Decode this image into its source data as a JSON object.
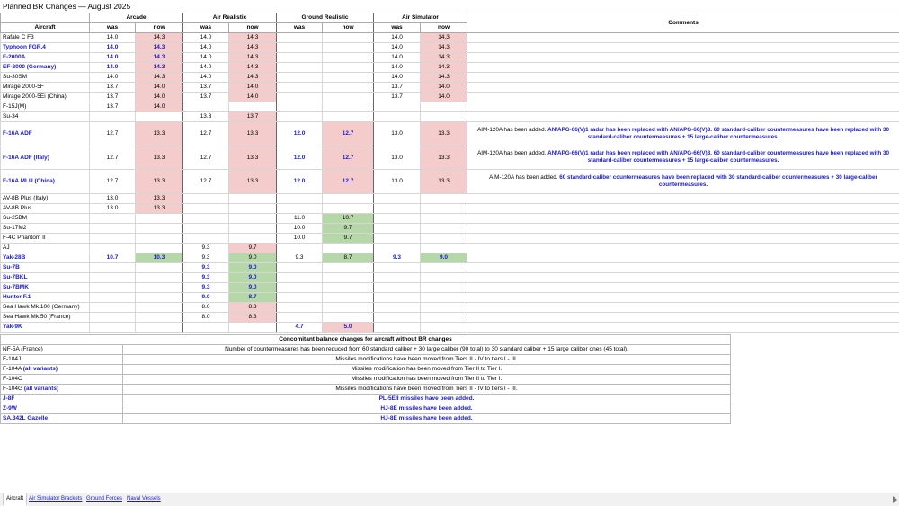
{
  "title": "Planned BR Changes — August 2025",
  "headers": {
    "aircraft": "Aircraft",
    "comments": "Comments",
    "modes": [
      "Arcade",
      "Air Realistic",
      "Ground Realistic",
      "Air Simulator"
    ],
    "was": "was",
    "now": "now"
  },
  "rows": [
    {
      "name": "Rafale C F3",
      "name_style": "",
      "cells": [
        {
          "t": "14.0"
        },
        {
          "t": "14.3",
          "bg": "red"
        },
        {
          "t": "14.0"
        },
        {
          "t": "14.3",
          "bg": "red"
        },
        {
          "t": ""
        },
        {
          "t": ""
        },
        {
          "t": "14.0"
        },
        {
          "t": "14.3",
          "bg": "red"
        }
      ]
    },
    {
      "name": "Typhoon FGR.4",
      "name_style": "blue",
      "cells": [
        {
          "t": "14.0",
          "s": "blue"
        },
        {
          "t": "14.3",
          "bg": "red",
          "s": "blue"
        },
        {
          "t": "14.0"
        },
        {
          "t": "14.3",
          "bg": "red"
        },
        {
          "t": ""
        },
        {
          "t": ""
        },
        {
          "t": "14.0"
        },
        {
          "t": "14.3",
          "bg": "red"
        }
      ]
    },
    {
      "name": "F-2000A",
      "name_style": "blue",
      "cells": [
        {
          "t": "14.0",
          "s": "blue"
        },
        {
          "t": "14.3",
          "bg": "red",
          "s": "blue"
        },
        {
          "t": "14.0"
        },
        {
          "t": "14.3",
          "bg": "red"
        },
        {
          "t": ""
        },
        {
          "t": ""
        },
        {
          "t": "14.0"
        },
        {
          "t": "14.3",
          "bg": "red"
        }
      ]
    },
    {
      "name": "EF-2000 (Germany)",
      "name_style": "blue",
      "cells": [
        {
          "t": "14.0",
          "s": "blue"
        },
        {
          "t": "14.3",
          "bg": "red",
          "s": "blue"
        },
        {
          "t": "14.0"
        },
        {
          "t": "14.3",
          "bg": "red"
        },
        {
          "t": ""
        },
        {
          "t": ""
        },
        {
          "t": "14.0"
        },
        {
          "t": "14.3",
          "bg": "red"
        }
      ]
    },
    {
      "name": "Su-30SM",
      "name_style": "",
      "cells": [
        {
          "t": "14.0"
        },
        {
          "t": "14.3",
          "bg": "red"
        },
        {
          "t": "14.0"
        },
        {
          "t": "14.3",
          "bg": "red"
        },
        {
          "t": ""
        },
        {
          "t": ""
        },
        {
          "t": "14.0"
        },
        {
          "t": "14.3",
          "bg": "red"
        }
      ]
    },
    {
      "name": "Mirage 2000-5F",
      "name_style": "",
      "cells": [
        {
          "t": "13.7"
        },
        {
          "t": "14.0",
          "bg": "red"
        },
        {
          "t": "13.7"
        },
        {
          "t": "14.0",
          "bg": "red"
        },
        {
          "t": ""
        },
        {
          "t": ""
        },
        {
          "t": "13.7"
        },
        {
          "t": "14.0",
          "bg": "red"
        }
      ]
    },
    {
      "name": "Mirage 2000-5Ei (China)",
      "name_style": "",
      "cells": [
        {
          "t": "13.7"
        },
        {
          "t": "14.0",
          "bg": "red"
        },
        {
          "t": "13.7"
        },
        {
          "t": "14.0",
          "bg": "red"
        },
        {
          "t": ""
        },
        {
          "t": ""
        },
        {
          "t": "13.7"
        },
        {
          "t": "14.0",
          "bg": "red"
        }
      ]
    },
    {
      "name": "F-15J(M)",
      "name_style": "",
      "cells": [
        {
          "t": "13.7"
        },
        {
          "t": "14.0",
          "bg": "red"
        },
        {
          "t": ""
        },
        {
          "t": ""
        },
        {
          "t": ""
        },
        {
          "t": ""
        },
        {
          "t": ""
        },
        {
          "t": ""
        }
      ]
    },
    {
      "name": "Su-34",
      "name_style": "",
      "cells": [
        {
          "t": ""
        },
        {
          "t": ""
        },
        {
          "t": "13.3"
        },
        {
          "t": "13.7",
          "bg": "red"
        },
        {
          "t": ""
        },
        {
          "t": ""
        },
        {
          "t": ""
        },
        {
          "t": ""
        }
      ]
    },
    {
      "name": "F-16A ADF",
      "name_style": "blue",
      "tall": true,
      "cells": [
        {
          "t": "12.7"
        },
        {
          "t": "13.3",
          "bg": "red"
        },
        {
          "t": "12.7"
        },
        {
          "t": "13.3",
          "bg": "red"
        },
        {
          "t": "12.0",
          "s": "blue"
        },
        {
          "t": "12.7",
          "bg": "red",
          "s": "blue"
        },
        {
          "t": "13.0"
        },
        {
          "t": "13.3",
          "bg": "red"
        }
      ],
      "comment_plain": "AIM-120A has been added. ",
      "comment_blue": "AN/APG-66(V)1 radar has been replaced with AN/APG-66(V)3. 60 standard-caliber countermeasures have been replaced with 30 standard-caliber countermeasures + 15 large-caliber countermeasures."
    },
    {
      "name": "F-16A ADF (Italy)",
      "name_style": "blue",
      "tall": true,
      "cells": [
        {
          "t": "12.7"
        },
        {
          "t": "13.3",
          "bg": "red"
        },
        {
          "t": "12.7"
        },
        {
          "t": "13.3",
          "bg": "red"
        },
        {
          "t": "12.0",
          "s": "blue"
        },
        {
          "t": "12.7",
          "bg": "red",
          "s": "blue"
        },
        {
          "t": "13.0"
        },
        {
          "t": "13.3",
          "bg": "red"
        }
      ],
      "comment_plain": "AIM-120A has been added. ",
      "comment_blue": "AN/APG-66(V)1 radar has been replaced with AN/APG-66(V)3. 60 standard-caliber countermeasures have been replaced with 30 standard-caliber countermeasures + 15 large-caliber countermeasures."
    },
    {
      "name": "F-16A MLU (China)",
      "name_style": "blue",
      "tall": true,
      "cells": [
        {
          "t": "12.7"
        },
        {
          "t": "13.3",
          "bg": "red"
        },
        {
          "t": "12.7"
        },
        {
          "t": "13.3",
          "bg": "red"
        },
        {
          "t": "12.0",
          "s": "blue"
        },
        {
          "t": "12.7",
          "bg": "red",
          "s": "blue"
        },
        {
          "t": "13.0"
        },
        {
          "t": "13.3",
          "bg": "red"
        }
      ],
      "comment_plain": "AIM-120A has been added. ",
      "comment_blue": "60 standard-caliber countermeasures have been replaced with 30 standard-caliber countermeasures + 30 large-caliber countermeasures."
    },
    {
      "name": "AV-8B Plus (Italy)",
      "name_style": "",
      "cells": [
        {
          "t": "13.0"
        },
        {
          "t": "13.3",
          "bg": "red"
        },
        {
          "t": ""
        },
        {
          "t": ""
        },
        {
          "t": ""
        },
        {
          "t": ""
        },
        {
          "t": ""
        },
        {
          "t": ""
        }
      ]
    },
    {
      "name": "AV-8B Plus",
      "name_style": "",
      "cells": [
        {
          "t": "13.0"
        },
        {
          "t": "13.3",
          "bg": "red"
        },
        {
          "t": ""
        },
        {
          "t": ""
        },
        {
          "t": ""
        },
        {
          "t": ""
        },
        {
          "t": ""
        },
        {
          "t": ""
        }
      ]
    },
    {
      "name": "Su-25BM",
      "name_style": "",
      "cells": [
        {
          "t": ""
        },
        {
          "t": ""
        },
        {
          "t": ""
        },
        {
          "t": ""
        },
        {
          "t": "11.0"
        },
        {
          "t": "10.7",
          "bg": "green"
        },
        {
          "t": ""
        },
        {
          "t": ""
        }
      ]
    },
    {
      "name": "Su-17M2",
      "name_style": "",
      "cells": [
        {
          "t": ""
        },
        {
          "t": ""
        },
        {
          "t": ""
        },
        {
          "t": ""
        },
        {
          "t": "10.0"
        },
        {
          "t": "9.7",
          "bg": "green"
        },
        {
          "t": ""
        },
        {
          "t": ""
        }
      ]
    },
    {
      "name": "F-4C Phantom II",
      "name_style": "",
      "cells": [
        {
          "t": ""
        },
        {
          "t": ""
        },
        {
          "t": ""
        },
        {
          "t": ""
        },
        {
          "t": "10.0"
        },
        {
          "t": "9.7",
          "bg": "green"
        },
        {
          "t": ""
        },
        {
          "t": ""
        }
      ]
    },
    {
      "name": "AJ                     ",
      "name_style": "",
      "cells": [
        {
          "t": ""
        },
        {
          "t": ""
        },
        {
          "t": "9.3"
        },
        {
          "t": "9.7",
          "bg": "red"
        },
        {
          "t": ""
        },
        {
          "t": ""
        },
        {
          "t": ""
        },
        {
          "t": ""
        }
      ]
    },
    {
      "name": "Yak-28B",
      "name_style": "blue",
      "cells": [
        {
          "t": "10.7",
          "s": "blue"
        },
        {
          "t": "10.3",
          "bg": "green",
          "s": "blue"
        },
        {
          "t": "9.3"
        },
        {
          "t": "9.0",
          "bg": "green"
        },
        {
          "t": "9.3"
        },
        {
          "t": "8.7",
          "bg": "green"
        },
        {
          "t": "9.3",
          "s": "blue"
        },
        {
          "t": "9.0",
          "bg": "green",
          "s": "blue"
        }
      ]
    },
    {
      "name": "Su-7B",
      "name_style": "blue",
      "cells": [
        {
          "t": ""
        },
        {
          "t": ""
        },
        {
          "t": "9.3",
          "s": "blue"
        },
        {
          "t": "9.0",
          "bg": "green",
          "s": "blue"
        },
        {
          "t": ""
        },
        {
          "t": ""
        },
        {
          "t": ""
        },
        {
          "t": ""
        }
      ]
    },
    {
      "name": "Su-7BKL",
      "name_style": "blue",
      "cells": [
        {
          "t": ""
        },
        {
          "t": ""
        },
        {
          "t": "9.3",
          "s": "blue"
        },
        {
          "t": "9.0",
          "bg": "green",
          "s": "blue"
        },
        {
          "t": ""
        },
        {
          "t": ""
        },
        {
          "t": ""
        },
        {
          "t": ""
        }
      ]
    },
    {
      "name": "Su-7BMK",
      "name_style": "blue",
      "cells": [
        {
          "t": ""
        },
        {
          "t": ""
        },
        {
          "t": "9.3",
          "s": "blue"
        },
        {
          "t": "9.0",
          "bg": "green",
          "s": "blue"
        },
        {
          "t": ""
        },
        {
          "t": ""
        },
        {
          "t": ""
        },
        {
          "t": ""
        }
      ]
    },
    {
      "name": "Hunter F.1",
      "name_style": "blue",
      "cells": [
        {
          "t": ""
        },
        {
          "t": ""
        },
        {
          "t": "9.0",
          "s": "blue"
        },
        {
          "t": "8.7",
          "bg": "green",
          "s": "blue"
        },
        {
          "t": ""
        },
        {
          "t": ""
        },
        {
          "t": ""
        },
        {
          "t": ""
        }
      ]
    },
    {
      "name": "Sea Hawk Mk.100 (Germany)",
      "name_style": "",
      "cells": [
        {
          "t": ""
        },
        {
          "t": ""
        },
        {
          "t": "8.0"
        },
        {
          "t": "8.3",
          "bg": "red"
        },
        {
          "t": ""
        },
        {
          "t": ""
        },
        {
          "t": ""
        },
        {
          "t": ""
        }
      ]
    },
    {
      "name": "Sea Hawk Mk.50 (France)",
      "name_style": "",
      "cells": [
        {
          "t": ""
        },
        {
          "t": ""
        },
        {
          "t": "8.0"
        },
        {
          "t": "8.3",
          "bg": "red"
        },
        {
          "t": ""
        },
        {
          "t": ""
        },
        {
          "t": ""
        },
        {
          "t": ""
        }
      ]
    },
    {
      "name": "Yak-9K",
      "name_style": "blue",
      "cells": [
        {
          "t": ""
        },
        {
          "t": ""
        },
        {
          "t": ""
        },
        {
          "t": ""
        },
        {
          "t": "4.7",
          "s": "blue"
        },
        {
          "t": "5.0",
          "bg": "red",
          "s": "blue"
        },
        {
          "t": ""
        },
        {
          "t": ""
        }
      ]
    }
  ],
  "balance": {
    "title": "Concomitant balance changes for aircraft without BR changes",
    "rows": [
      {
        "name": "NF-5A (France)",
        "name_style": "",
        "suffix": "",
        "desc": "Number of countermeasures has been reduced from 60 standard caliber + 30 large caliber (90 total) to 30 standard caliber + 15 large caliber ones (45 total).",
        "desc_style": ""
      },
      {
        "name": "F-104J",
        "name_style": "",
        "suffix": "",
        "desc": "Missiles modifications have been moved from Tiers II - IV to tiers I - III.",
        "desc_style": ""
      },
      {
        "name": "F-104A ",
        "name_style": "",
        "suffix": "(all variants)",
        "desc": "Missiles modification has been moved from Tier II to Tier I.",
        "desc_style": ""
      },
      {
        "name": "F-104C",
        "name_style": "",
        "suffix": "",
        "desc": "Missiles modification has been moved from Tier II to Tier I.",
        "desc_style": ""
      },
      {
        "name": "F-104G ",
        "name_style": "",
        "suffix": "(all variants)",
        "desc": "Missiles modifications have been moved from Tiers II - IV to tiers I - III.",
        "desc_style": ""
      },
      {
        "name": "J-8F",
        "name_style": "blue",
        "suffix": "",
        "desc": "PL-5EII missiles have been added.",
        "desc_style": "blue"
      },
      {
        "name": "Z-9W",
        "name_style": "blue",
        "suffix": "",
        "desc": "HJ-8E missiles have been added.",
        "desc_style": "blue"
      },
      {
        "name": "SA.342L Gazelle",
        "name_style": "blue",
        "suffix": "",
        "desc": "HJ-8E missiles have been added.",
        "desc_style": "blue"
      }
    ]
  },
  "tabs": [
    {
      "label": "Aircraft",
      "active": true
    },
    {
      "label": "Air Simulator Brackets",
      "active": false
    },
    {
      "label": "Ground Forces",
      "active": false
    },
    {
      "label": "Naval Vessels",
      "active": false
    }
  ],
  "colors": {
    "now_increase": "#f4cccc",
    "now_decrease": "#b6d7a8",
    "highlight_text": "#1a1acc"
  }
}
